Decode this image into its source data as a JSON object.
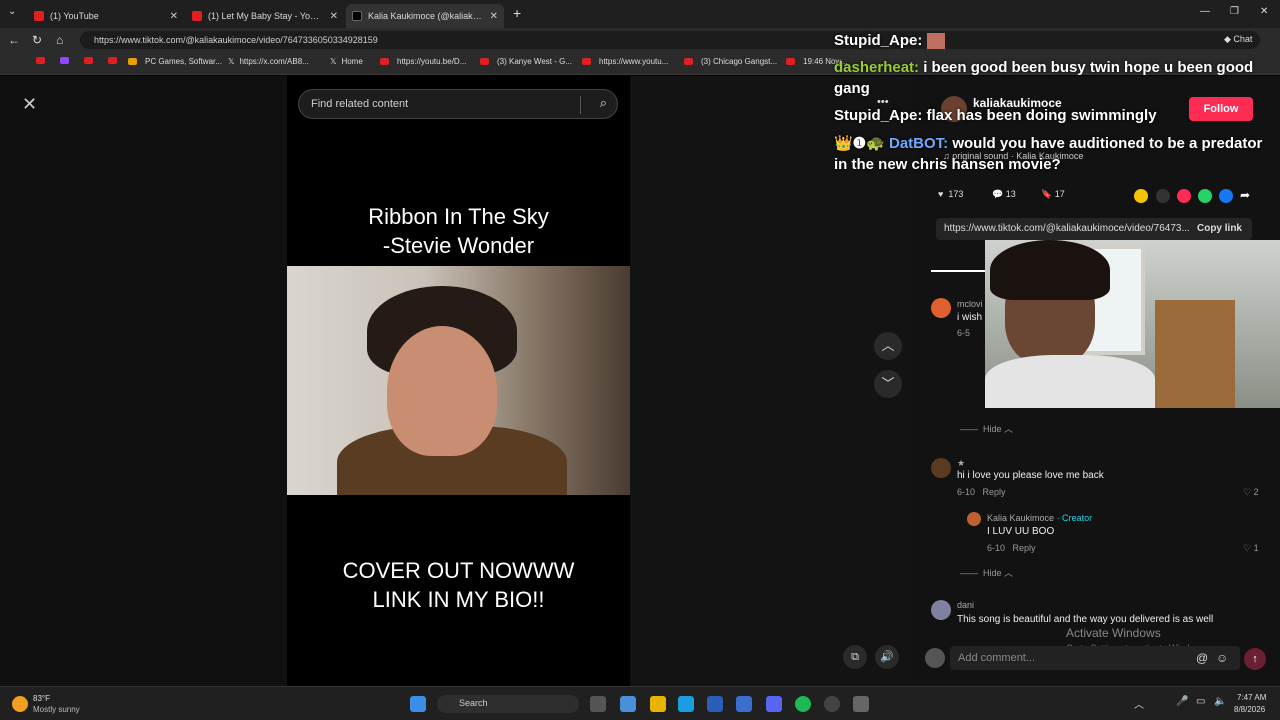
{
  "browser": {
    "tabs": [
      {
        "title": "(1) YouTube"
      },
      {
        "title": "(1) Let My Baby Stay - YouTube"
      },
      {
        "title": "Kalia Kaukimoce (@kaliakauki"
      }
    ],
    "new_tab": "+",
    "url": "https://www.tiktok.com/@kaliakaukimoce/video/7647336050334928159",
    "chat_label": "Chat",
    "bookmarks": [
      "PC Games, Softwar...",
      "https://x.com/AB8...",
      "Home",
      "https://youtu.be/D...",
      "(3) Kanye West - G...",
      "https://www.youtu...",
      "(3) Chicago Gangst...",
      "19:46 Now..."
    ]
  },
  "tiktok": {
    "search_placeholder": "Find related content",
    "video_title_line1": "Ribbon In The Sky",
    "video_title_line2": "-Stevie Wonder",
    "video_caption_line1": "COVER OUT NOWWW",
    "video_caption_line2": "LINK IN MY BIO!!",
    "username": "kaliakaukimoce",
    "follow_label": "Follow",
    "more": "•••",
    "sound": "original sound · Kalia Kaukimoce",
    "likes": "173",
    "comments_count": "13",
    "saves": "17",
    "copy_url": "https://www.tiktok.com/@kaliakaukimoce/video/76473...",
    "copy_label": "Copy link",
    "comments": [
      {
        "name": "mclovi",
        "text": "i wish",
        "meta": "6-5"
      },
      {
        "name": "★",
        "text": "hi i love you please love me back",
        "date": "6-10",
        "reply": "Reply",
        "likes": "2"
      },
      {
        "name": "Kalia Kaukimoce",
        "creator": "· Creator",
        "text": "I LUV UU BOO",
        "date": "6-10",
        "reply": "Reply",
        "likes": "1"
      },
      {
        "name": "dani",
        "text": "This song is beautiful and the way you delivered is as well"
      }
    ],
    "hide_label": "Hide",
    "reply_label": "Reply",
    "add_comment": "Add comment...",
    "activate_title": "Activate Windows",
    "activate_sub": "Go to Settings to activate Windows."
  },
  "stream_chat": [
    {
      "user": "Stupid_Ape:",
      "msg": "",
      "color": "#ffffff"
    },
    {
      "user": "dasherheat:",
      "msg": "i been good been busy twin hope u been good gang",
      "color": "#9acd32"
    },
    {
      "user": "Stupid_Ape:",
      "msg": "flax has been doing swimmingly",
      "color": "#ffffff"
    },
    {
      "user": "DatBOT:",
      "msg": "would you have auditioned to be a predator in the new chris hansen movie?",
      "color": "#6fa8ff"
    }
  ],
  "taskbar": {
    "temp": "83°F",
    "weather": "Mostly sunny",
    "search": "Search",
    "time": "7:47 AM",
    "date": "8/8/2026"
  }
}
